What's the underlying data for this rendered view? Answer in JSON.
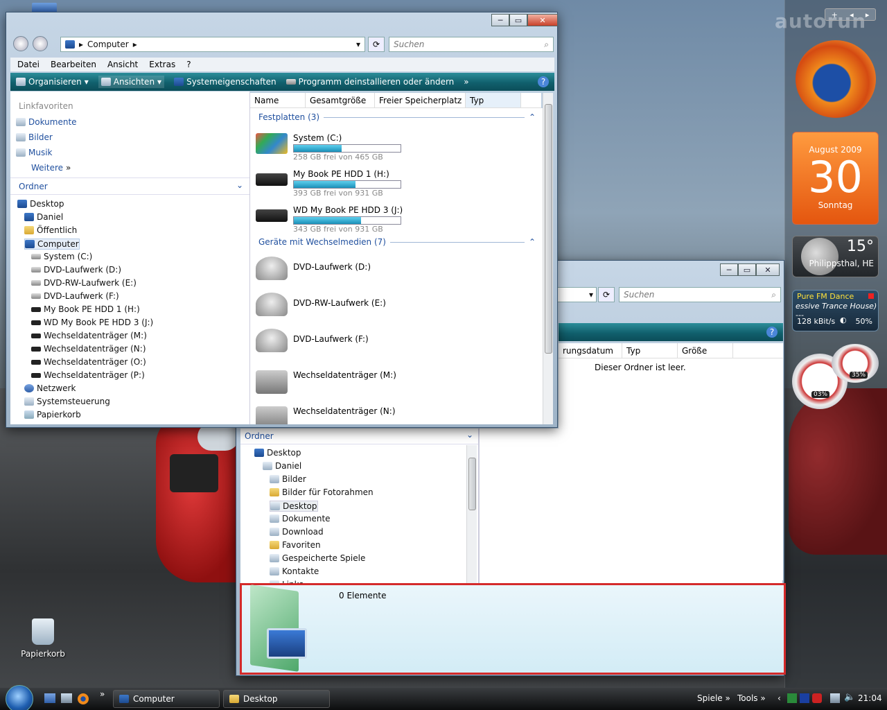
{
  "win1": {
    "address": "Computer",
    "search_placeholder": "Suchen",
    "menu": [
      "Datei",
      "Bearbeiten",
      "Ansicht",
      "Extras",
      "?"
    ],
    "cmd": {
      "organize": "Organisieren",
      "views": "Ansichten",
      "sysprops": "Systemeigenschaften",
      "uninstall": "Programm deinstallieren oder ändern",
      "more": "»"
    },
    "favorites_header": "Linkfavoriten",
    "favorites": [
      "Dokumente",
      "Bilder",
      "Musik",
      "Weitere"
    ],
    "folders_header": "Ordner",
    "tree": [
      "Desktop",
      "Daniel",
      "Öffentlich",
      "Computer",
      "System (C:)",
      "DVD-Laufwerk (D:)",
      "DVD-RW-Laufwerk (E:)",
      "DVD-Laufwerk (F:)",
      "My Book PE HDD 1 (H:)",
      "WD My Book PE HDD 3 (J:)",
      "Wechseldatenträger (M:)",
      "Wechseldatenträger (N:)",
      "Wechseldatenträger (O:)",
      "Wechseldatenträger (P:)",
      "Netzwerk",
      "Systemsteuerung",
      "Papierkorb"
    ],
    "columns": [
      "Name",
      "Gesamtgröße",
      "Freier Speicherplatz",
      "Typ"
    ],
    "group_hdd": "Festplatten (3)",
    "group_removable": "Geräte mit Wechselmedien (7)",
    "drives": [
      {
        "name": "System (C:)",
        "free": "258 GB frei von 465 GB",
        "used_fraction": 0.45
      },
      {
        "name": "My Book PE HDD 1 (H:)",
        "free": "393 GB frei von 931 GB",
        "used_fraction": 0.58
      },
      {
        "name": "WD My Book PE HDD 3 (J:)",
        "free": "343 GB frei von 931 GB",
        "used_fraction": 0.63
      }
    ],
    "removable": [
      "DVD-Laufwerk (D:)",
      "DVD-RW-Laufwerk (E:)",
      "DVD-Laufwerk (F:)",
      "Wechseldatenträger (M:)",
      "Wechseldatenträger (N:)"
    ]
  },
  "win2": {
    "search_placeholder": "Suchen",
    "columns": [
      "rungsdatum",
      "Typ",
      "Größe"
    ],
    "empty_text": "Dieser Ordner ist leer.",
    "folders_header": "Ordner",
    "tree": [
      "Desktop",
      "Daniel",
      "Bilder",
      "Bilder für Fotorahmen",
      "Desktop",
      "Dokumente",
      "Download",
      "Favoriten",
      "Gespeicherte Spiele",
      "Kontakte",
      "Links"
    ],
    "details_count": "0 Elemente"
  },
  "gadgets": {
    "calendar_month": "August 2009",
    "calendar_day": "30",
    "calendar_weekday": "Sonntag",
    "weather_temp": "15°",
    "weather_city": "Philippsthal, HE",
    "radio_title": "Pure FM Dance",
    "radio_sub": "essive Trance House) ---",
    "radio_rate": "128 kBit/s",
    "radio_volume": "50%",
    "cpu_a": "03%",
    "cpu_b": "35%",
    "top_text": "autorun"
  },
  "desktop": {
    "recycle_bin": "Papierkorb"
  },
  "taskbar": {
    "btn1": "Computer",
    "btn2": "Desktop",
    "spiele": "Spiele",
    "tools": "Tools",
    "clock": "21:04"
  }
}
